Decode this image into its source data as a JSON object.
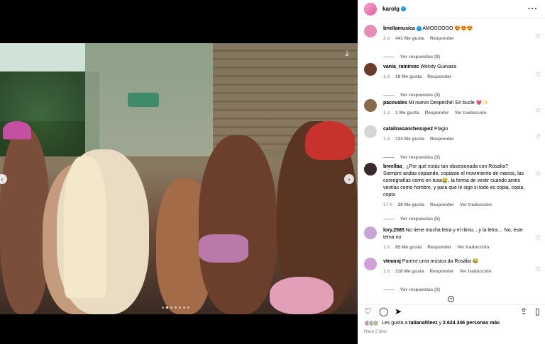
{
  "post": {
    "author": "karolg",
    "verified": true,
    "carousel": {
      "total": 7,
      "active_index": 1
    }
  },
  "comments": [
    {
      "user": "briellamusica",
      "verified": true,
      "text": "AMOOOOOO 😍😍😍",
      "time": "2 d",
      "likes": "441 Me gusta",
      "reply": "Responder",
      "translate": "",
      "replies": "Ver respuestas (8)",
      "avatar_color": "#e58fb7"
    },
    {
      "user": "vania_ramirezc",
      "verified": false,
      "text": "Wendy Guevara",
      "time": "1 d",
      "likes": "19 Me gusta",
      "reply": "Responder",
      "translate": "",
      "replies": "Ver respuestas (4)",
      "avatar_color": "#6b3a2a"
    },
    {
      "user": "pacovales",
      "verified": false,
      "text": "Mi nuevo Despeché! En bucle 💗✨",
      "time": "1 d",
      "likes": "1 Me gusta",
      "reply": "Responder",
      "translate": "Ver traducción",
      "replies": "",
      "avatar_color": "#8a6a4a"
    },
    {
      "user": "catalinasanchezupe2",
      "verified": false,
      "text": "Plagio",
      "time": "1 d",
      "likes": "134 Me gusta",
      "reply": "Responder",
      "translate": "",
      "replies": "Ver respuestas (3)",
      "avatar_color": "#d6d6d6"
    },
    {
      "user": "breellaa_",
      "verified": false,
      "text": "¿Por qué estás tan obsesionada con Rosalía? Siempre andas copiando, copiaste el movimiento de manos, las coreografías como en tusa🤮, la forma de vestir cuando antes vestías como hombre, y para que le sigo si todo es copia, copia, copia",
      "time": "17 h",
      "likes": "26 Me gusta",
      "reply": "Responder",
      "translate": "Ver traducción",
      "replies": "Ver respuestas (5)",
      "avatar_color": "#3a2a2a"
    },
    {
      "user": "lory.2585",
      "verified": false,
      "text": "No tiene mucha letra y el ritmo....y la letra.... No, este tema no",
      "time": "1 d",
      "likes": "85 Me gusta",
      "reply": "Responder",
      "translate": "Ver traducción",
      "replies": "",
      "avatar_color": "#c9a6d6"
    },
    {
      "user": "vtmaraj",
      "verified": false,
      "text": "Parece uma música da Rosália 😂",
      "time": "1 d",
      "likes": "118 Me gusta",
      "reply": "Responder",
      "translate": "Ver traducción",
      "replies": "Ver respuestas (3)",
      "avatar_color": "#d0a0d8"
    }
  ],
  "likes_line": {
    "prefix": "Les gusta a",
    "user": "tatianafdeez",
    "middle": "y",
    "count": "2.624.346 personas más"
  },
  "date": "Hace 2 días",
  "icons": {
    "more": "more-icon",
    "heart": "heart-icon",
    "comment": "comment-icon",
    "share": "share-icon",
    "save": "bookmark-icon",
    "repost": "repost-icon",
    "download": "download-icon"
  },
  "colors": {
    "accent": "#0095f6",
    "muted": "#737373"
  }
}
